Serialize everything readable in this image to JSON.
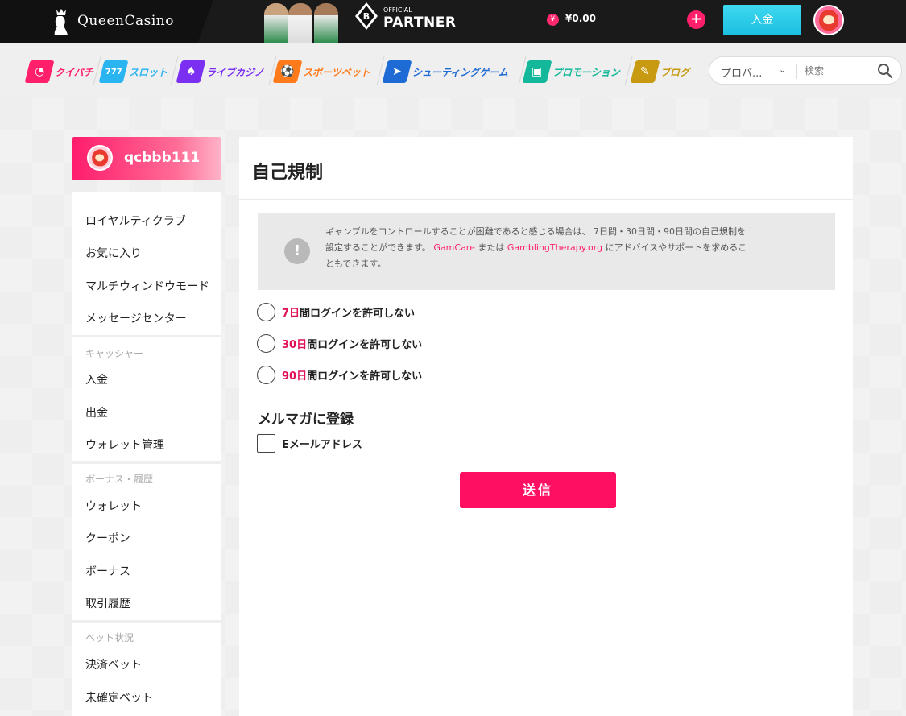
{
  "header": {
    "logo_text": "QueenCasino",
    "partner_small": "OFFICIAL",
    "partner_big": "PARTNER",
    "currency_symbol": "¥",
    "balance": "¥0.00",
    "plus_label": "+",
    "deposit_label": "入金"
  },
  "nav": {
    "items": [
      {
        "label": "クイパチ",
        "icon": "quick-pachi-icon",
        "color": "#ff1f6b"
      },
      {
        "label": "スロット",
        "icon": "slot-icon",
        "color": "#2bb5f0"
      },
      {
        "label": "ライブカジノ",
        "icon": "live-casino-icon",
        "color": "#7b2ff0"
      },
      {
        "label": "スポーツベット",
        "icon": "sports-ball-icon",
        "color": "#ff7a1a"
      },
      {
        "label": "シューティングゲーム",
        "icon": "fish-shooting-icon",
        "color": "#1f6bd6"
      },
      {
        "label": "プロモーション",
        "icon": "gift-icon",
        "color": "#13b89a"
      },
      {
        "label": "ブログ",
        "icon": "blog-chat-icon",
        "color": "#c79a12"
      }
    ],
    "provider_select": "プロバ...",
    "search_placeholder": "検索"
  },
  "sidebar": {
    "username": "qcbbb111",
    "links_top": [
      "ロイヤルティクラブ",
      "お気に入り",
      "マルチウィンドウモード",
      "メッセージセンター"
    ],
    "section_cashier": "キャッシャー",
    "links_cashier": [
      "入金",
      "出金",
      "ウォレット管理"
    ],
    "section_bonus": "ボーナス・履歴",
    "links_bonus": [
      "ウォレット",
      "クーポン",
      "ボーナス",
      "取引履歴"
    ],
    "section_bet": "ベット状況",
    "links_bet": [
      "決済ベット",
      "未確定ベット"
    ]
  },
  "main": {
    "title": "自己規制",
    "notice_line1": "ギャンブルをコントロールすることが困難であると感じる場合は、 7日間・30日間・90日間の自己規制を",
    "notice_line2_pre": "設定することができます。 ",
    "notice_link1": "GamCare",
    "notice_line2_mid": " または ",
    "notice_link2": "GamblingTherapy.org",
    "notice_line2_post": " にアドバイスやサポートを求めるこ",
    "notice_line3": "ともできます。",
    "options": [
      {
        "num": "7日",
        "rest": "間ログインを許可しない"
      },
      {
        "num": "30日",
        "rest": "間ログインを許可しない"
      },
      {
        "num": "90日",
        "rest": "間ログインを許可しない"
      }
    ],
    "newsletter_title": "メルマガに登録",
    "email_label": "Eメールアドレス",
    "submit_label": "送信"
  }
}
